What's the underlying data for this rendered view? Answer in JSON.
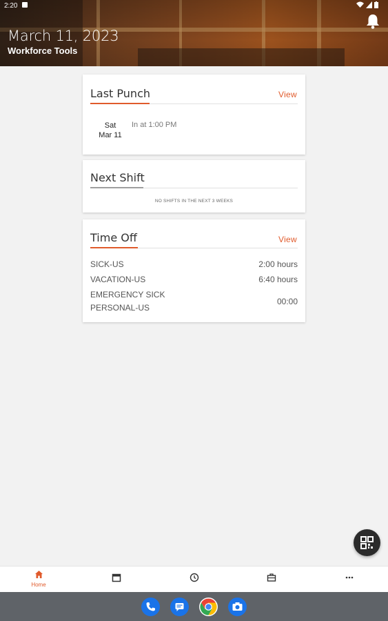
{
  "status_bar": {
    "time": "2:20"
  },
  "header": {
    "date": "March 11, 2023",
    "subtitle": "Workforce Tools"
  },
  "last_punch": {
    "title": "Last Punch",
    "view_label": "View",
    "day": "Sat",
    "date": "Mar 11",
    "text": "In at 1:00 PM"
  },
  "next_shift": {
    "title": "Next Shift",
    "empty_text": "NO SHIFTS IN THE NEXT 3 WEEKS"
  },
  "time_off": {
    "title": "Time Off",
    "view_label": "View",
    "rows": [
      {
        "name": "SICK-US",
        "value": "2:00 hours"
      },
      {
        "name": "VACATION-US",
        "value": "6:40 hours"
      },
      {
        "name": "EMERGENCY SICK",
        "value": "00:00"
      },
      {
        "name": "PERSONAL-US",
        "value": ""
      }
    ]
  },
  "bottom_nav": {
    "home_label": "Home"
  },
  "icons": [
    "bell-icon",
    "qr-code-icon",
    "home-icon",
    "calendar-icon",
    "clock-icon",
    "briefcase-icon",
    "more-icon",
    "phone-icon",
    "messages-icon",
    "chrome-icon",
    "camera-icon"
  ],
  "colors": {
    "accent": "#e05a2b",
    "background": "#f2f2f2",
    "dock": "#5f6368"
  }
}
